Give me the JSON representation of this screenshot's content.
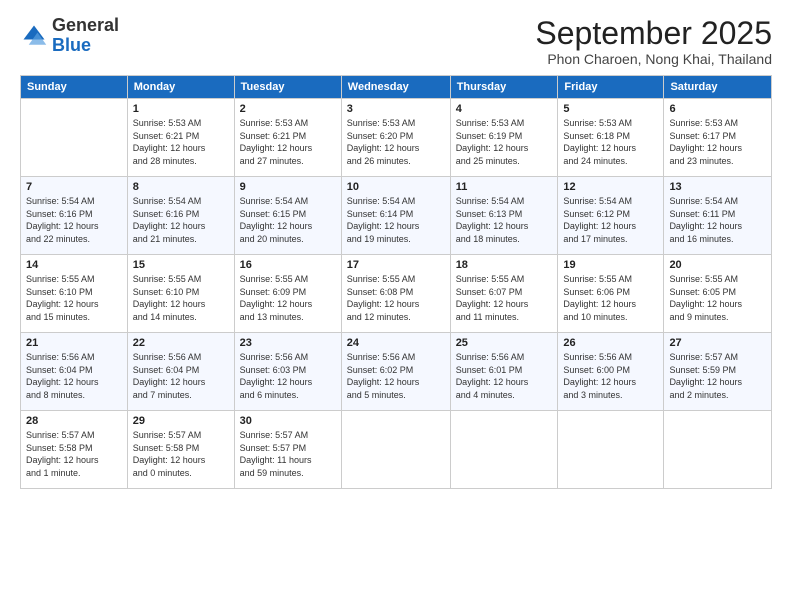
{
  "logo": {
    "general": "General",
    "blue": "Blue"
  },
  "title": "September 2025",
  "location": "Phon Charoen, Nong Khai, Thailand",
  "days_of_week": [
    "Sunday",
    "Monday",
    "Tuesday",
    "Wednesday",
    "Thursday",
    "Friday",
    "Saturday"
  ],
  "weeks": [
    [
      {
        "day": "",
        "info": ""
      },
      {
        "day": "1",
        "info": "Sunrise: 5:53 AM\nSunset: 6:21 PM\nDaylight: 12 hours\nand 28 minutes."
      },
      {
        "day": "2",
        "info": "Sunrise: 5:53 AM\nSunset: 6:21 PM\nDaylight: 12 hours\nand 27 minutes."
      },
      {
        "day": "3",
        "info": "Sunrise: 5:53 AM\nSunset: 6:20 PM\nDaylight: 12 hours\nand 26 minutes."
      },
      {
        "day": "4",
        "info": "Sunrise: 5:53 AM\nSunset: 6:19 PM\nDaylight: 12 hours\nand 25 minutes."
      },
      {
        "day": "5",
        "info": "Sunrise: 5:53 AM\nSunset: 6:18 PM\nDaylight: 12 hours\nand 24 minutes."
      },
      {
        "day": "6",
        "info": "Sunrise: 5:53 AM\nSunset: 6:17 PM\nDaylight: 12 hours\nand 23 minutes."
      }
    ],
    [
      {
        "day": "7",
        "info": "Sunrise: 5:54 AM\nSunset: 6:16 PM\nDaylight: 12 hours\nand 22 minutes."
      },
      {
        "day": "8",
        "info": "Sunrise: 5:54 AM\nSunset: 6:16 PM\nDaylight: 12 hours\nand 21 minutes."
      },
      {
        "day": "9",
        "info": "Sunrise: 5:54 AM\nSunset: 6:15 PM\nDaylight: 12 hours\nand 20 minutes."
      },
      {
        "day": "10",
        "info": "Sunrise: 5:54 AM\nSunset: 6:14 PM\nDaylight: 12 hours\nand 19 minutes."
      },
      {
        "day": "11",
        "info": "Sunrise: 5:54 AM\nSunset: 6:13 PM\nDaylight: 12 hours\nand 18 minutes."
      },
      {
        "day": "12",
        "info": "Sunrise: 5:54 AM\nSunset: 6:12 PM\nDaylight: 12 hours\nand 17 minutes."
      },
      {
        "day": "13",
        "info": "Sunrise: 5:54 AM\nSunset: 6:11 PM\nDaylight: 12 hours\nand 16 minutes."
      }
    ],
    [
      {
        "day": "14",
        "info": "Sunrise: 5:55 AM\nSunset: 6:10 PM\nDaylight: 12 hours\nand 15 minutes."
      },
      {
        "day": "15",
        "info": "Sunrise: 5:55 AM\nSunset: 6:10 PM\nDaylight: 12 hours\nand 14 minutes."
      },
      {
        "day": "16",
        "info": "Sunrise: 5:55 AM\nSunset: 6:09 PM\nDaylight: 12 hours\nand 13 minutes."
      },
      {
        "day": "17",
        "info": "Sunrise: 5:55 AM\nSunset: 6:08 PM\nDaylight: 12 hours\nand 12 minutes."
      },
      {
        "day": "18",
        "info": "Sunrise: 5:55 AM\nSunset: 6:07 PM\nDaylight: 12 hours\nand 11 minutes."
      },
      {
        "day": "19",
        "info": "Sunrise: 5:55 AM\nSunset: 6:06 PM\nDaylight: 12 hours\nand 10 minutes."
      },
      {
        "day": "20",
        "info": "Sunrise: 5:55 AM\nSunset: 6:05 PM\nDaylight: 12 hours\nand 9 minutes."
      }
    ],
    [
      {
        "day": "21",
        "info": "Sunrise: 5:56 AM\nSunset: 6:04 PM\nDaylight: 12 hours\nand 8 minutes."
      },
      {
        "day": "22",
        "info": "Sunrise: 5:56 AM\nSunset: 6:04 PM\nDaylight: 12 hours\nand 7 minutes."
      },
      {
        "day": "23",
        "info": "Sunrise: 5:56 AM\nSunset: 6:03 PM\nDaylight: 12 hours\nand 6 minutes."
      },
      {
        "day": "24",
        "info": "Sunrise: 5:56 AM\nSunset: 6:02 PM\nDaylight: 12 hours\nand 5 minutes."
      },
      {
        "day": "25",
        "info": "Sunrise: 5:56 AM\nSunset: 6:01 PM\nDaylight: 12 hours\nand 4 minutes."
      },
      {
        "day": "26",
        "info": "Sunrise: 5:56 AM\nSunset: 6:00 PM\nDaylight: 12 hours\nand 3 minutes."
      },
      {
        "day": "27",
        "info": "Sunrise: 5:57 AM\nSunset: 5:59 PM\nDaylight: 12 hours\nand 2 minutes."
      }
    ],
    [
      {
        "day": "28",
        "info": "Sunrise: 5:57 AM\nSunset: 5:58 PM\nDaylight: 12 hours\nand 1 minute."
      },
      {
        "day": "29",
        "info": "Sunrise: 5:57 AM\nSunset: 5:58 PM\nDaylight: 12 hours\nand 0 minutes."
      },
      {
        "day": "30",
        "info": "Sunrise: 5:57 AM\nSunset: 5:57 PM\nDaylight: 11 hours\nand 59 minutes."
      },
      {
        "day": "",
        "info": ""
      },
      {
        "day": "",
        "info": ""
      },
      {
        "day": "",
        "info": ""
      },
      {
        "day": "",
        "info": ""
      }
    ]
  ]
}
